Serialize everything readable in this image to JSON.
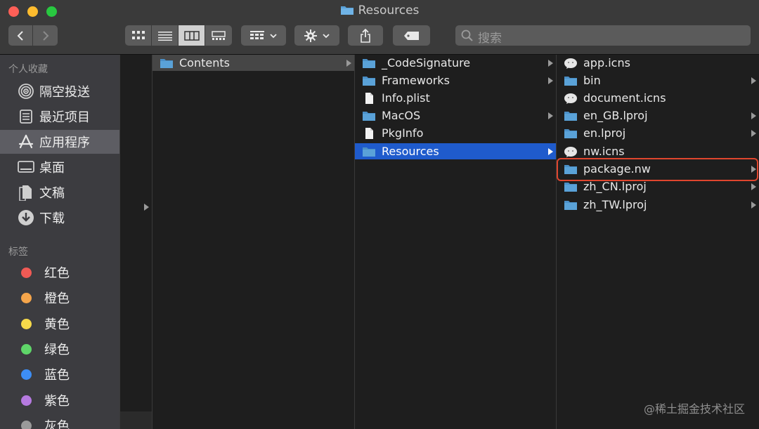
{
  "window": {
    "title": "Resources"
  },
  "toolbar": {
    "back_icon": "chevron-left-icon",
    "forward_icon": "chevron-right-icon",
    "search_placeholder": "搜索"
  },
  "sidebar": {
    "favorites_header": "个人收藏",
    "favorites": [
      {
        "label": "隔空投送",
        "icon": "airdrop-icon"
      },
      {
        "label": "最近项目",
        "icon": "recents-icon"
      },
      {
        "label": "应用程序",
        "icon": "applications-icon"
      },
      {
        "label": "桌面",
        "icon": "desktop-icon"
      },
      {
        "label": "文稿",
        "icon": "documents-icon"
      },
      {
        "label": "下载",
        "icon": "downloads-icon"
      }
    ],
    "tags_header": "标签",
    "tags": [
      {
        "label": "红色",
        "color": "#f05a55"
      },
      {
        "label": "橙色",
        "color": "#f5a54b"
      },
      {
        "label": "黄色",
        "color": "#f6d94a"
      },
      {
        "label": "绿色",
        "color": "#5fd669"
      },
      {
        "label": "蓝色",
        "color": "#3d8ef5"
      },
      {
        "label": "紫色",
        "color": "#b67ae0"
      },
      {
        "label": "灰色",
        "color": "#9a9a9a"
      }
    ]
  },
  "columns": {
    "col1": [
      {
        "label": "Contents",
        "type": "folder",
        "arrow": true
      }
    ],
    "col2": [
      {
        "label": "_CodeSignature",
        "type": "folder",
        "arrow": true
      },
      {
        "label": "Frameworks",
        "type": "folder",
        "arrow": true
      },
      {
        "label": "Info.plist",
        "type": "file",
        "arrow": false
      },
      {
        "label": "MacOS",
        "type": "folder",
        "arrow": true
      },
      {
        "label": "PkgInfo",
        "type": "file",
        "arrow": false
      },
      {
        "label": "Resources",
        "type": "folder",
        "arrow": true
      }
    ],
    "col3": [
      {
        "label": "app.icns",
        "type": "icns",
        "arrow": false
      },
      {
        "label": "bin",
        "type": "folder",
        "arrow": true
      },
      {
        "label": "document.icns",
        "type": "icns",
        "arrow": false
      },
      {
        "label": "en_GB.lproj",
        "type": "folder",
        "arrow": true
      },
      {
        "label": "en.lproj",
        "type": "folder",
        "arrow": true
      },
      {
        "label": "nw.icns",
        "type": "icns",
        "arrow": false
      },
      {
        "label": "package.nw",
        "type": "folder",
        "arrow": true
      },
      {
        "label": "zh_CN.lproj",
        "type": "folder",
        "arrow": true
      },
      {
        "label": "zh_TW.lproj",
        "type": "folder",
        "arrow": true
      }
    ]
  },
  "watermark": "@稀土掘金技术社区",
  "colors": {
    "accent": "#1f5bcc",
    "highlight": "#e0462e",
    "folder": "#5aa2d8"
  }
}
